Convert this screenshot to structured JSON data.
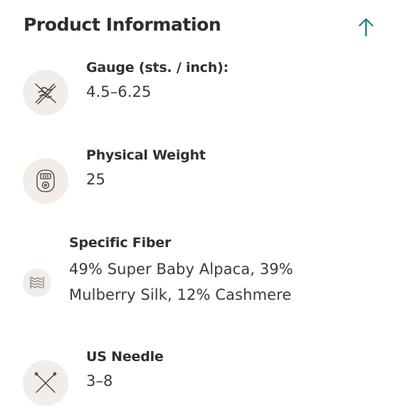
{
  "section": {
    "title": "Product Information",
    "collapse_icon": "arrow-up-icon",
    "accent_color": "#1f7a8c"
  },
  "specs": [
    {
      "icon": "knitting-gauge-icon",
      "label": "Gauge (sts. / inch):",
      "value": "4.5–6.25"
    },
    {
      "icon": "row-counter-icon",
      "label": "Physical Weight",
      "value": "25"
    },
    {
      "icon": "fiber-swatch-icon",
      "label": "Specific Fiber",
      "value": "49% Super Baby Alpaca, 39%\nMulberry Silk, 12% Cashmere"
    },
    {
      "icon": "crossed-needles-icon",
      "label": "US Needle",
      "value": "3–8"
    }
  ]
}
